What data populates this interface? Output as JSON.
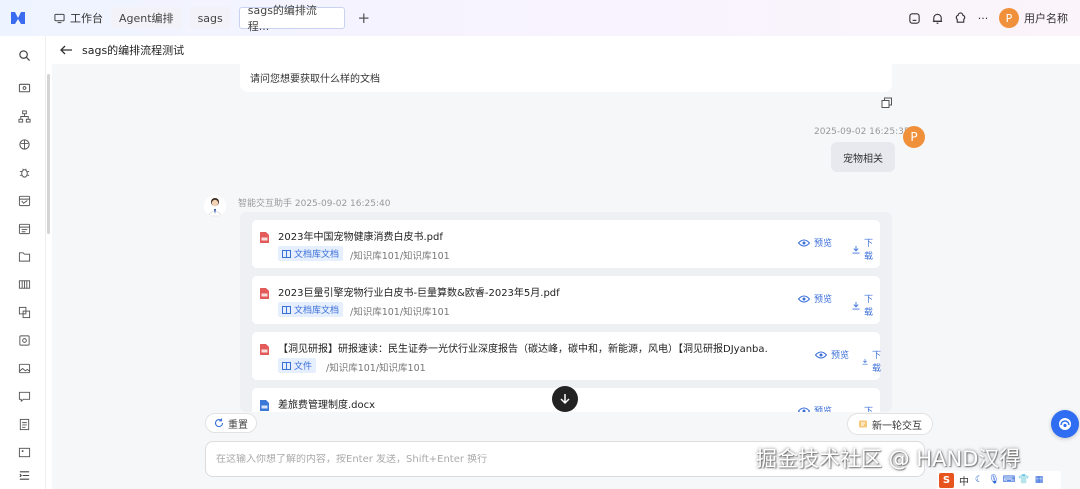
{
  "topbar": {
    "home_label": "工作台",
    "tabs": [
      {
        "label": "Agent编排"
      },
      {
        "label": "sags"
      },
      {
        "label": "sags的编排流程..."
      }
    ],
    "add_tab_label": "+",
    "more_label": "···",
    "user": {
      "avatar_letter": "P",
      "name": "用户名称"
    }
  },
  "header": {
    "title": "sags的编排流程测试"
  },
  "chat": {
    "bot_question": "请问您想要获取什么样的文档",
    "user_message": {
      "time": "2025-09-02 16:25:35",
      "avatar_letter": "P",
      "text": "宠物相关"
    },
    "bot_reply": {
      "meta": "智能交互助手 2025-09-02 16:25:40",
      "documents": [
        {
          "name": "2023年中国宠物健康消费白皮书.pdf",
          "tag": "文档库文档",
          "path": "/知识库101/知识库101",
          "type": "pdf"
        },
        {
          "name": "2023巨量引擎宠物行业白皮书-巨量算数&欧睿-2023年5月.pdf",
          "tag": "文档库文档",
          "path": "/知识库101/知识库101",
          "type": "pdf"
        },
        {
          "name": "【洞见研报】研报速读：民生证券一光伏行业深度报告（碳达峰，碳中和，新能源，风电）【洞见研报DJyanba…",
          "tag": "文件",
          "path": "/知识库101/知识库101",
          "type": "pdf"
        },
        {
          "name": "差旅费管理制度.docx",
          "tag": "",
          "path": "",
          "type": "docx"
        }
      ],
      "preview_label": "预览",
      "download_label": "下载"
    }
  },
  "controls": {
    "reset_label": "重置",
    "new_round_label": "新一轮交互",
    "input_placeholder": "在这输入你想了解的内容，按Enter 发送，Shift+Enter 换行"
  },
  "watermark": "掘金技术社区 @ HAND汉得",
  "ime": {
    "logo": "S",
    "lang": "中"
  },
  "colors": {
    "accent": "#2f6ef2",
    "avatar": "#f0903a",
    "link": "#3a6fd8"
  }
}
